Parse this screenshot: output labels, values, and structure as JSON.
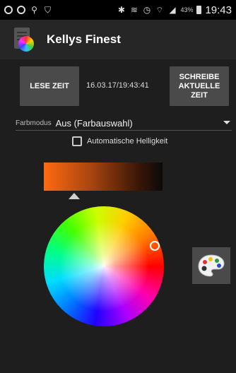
{
  "status_bar": {
    "battery": "43%",
    "time": "19:43"
  },
  "app": {
    "title": "Kellys Finest"
  },
  "controls": {
    "read_button": "LESE ZEIT",
    "datetime": "16.03.17/19:43:41",
    "write_button": "SCHREIBE AKTUELLE ZEIT"
  },
  "mode": {
    "label": "Farbmodus",
    "value": "Aus (Farbauswahl)"
  },
  "auto_brightness": {
    "label": "Automatische Helligkeit",
    "checked": false
  },
  "colors": {
    "selected_gradient_start": "#ff6a10",
    "gradient_end": "#0a0a0a",
    "button_bg": "#4a4a4a",
    "background": "#1e1e1e"
  },
  "icons": {
    "palette": "palette-icon",
    "color_wheel": "color-wheel"
  }
}
